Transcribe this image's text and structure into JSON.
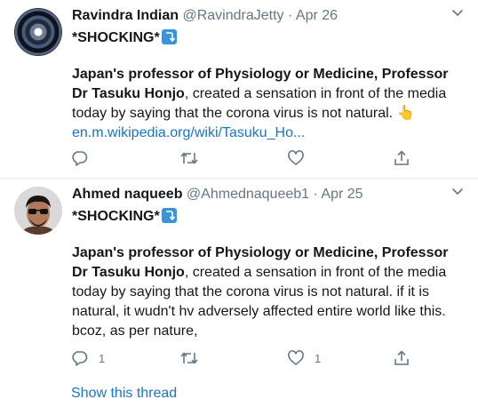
{
  "tweets": [
    {
      "display_name": "Ravindra Indian",
      "handle": "@RavindraJetty",
      "separator": "·",
      "date": "Apr 26",
      "shocking": "*SHOCKING*",
      "body_bold": "Japan's professor of Physiology or Medicine, Professor Dr Tasuku Honjo",
      "body_text": ", created a sensation in front of the media today by saying that the corona virus is not natural.",
      "emoji": "👆",
      "link": "en.m.wikipedia.org/wiki/Tasuku_Ho...",
      "reply_count": "",
      "like_count": ""
    },
    {
      "display_name": "Ahmed naqueeb",
      "handle": "@Ahmednaqueeb1",
      "separator": "·",
      "date": "Apr 25",
      "shocking": "*SHOCKING*",
      "body_bold": "Japan's professor of Physiology or Medicine, Professor Dr Tasuku Honjo",
      "body_text": ", created a sensation in front of the media today by saying that the corona virus is not natural. if it is natural, it wudn't hv adversely affected entire world like this. bcoz, as per nature,",
      "reply_count": "1",
      "like_count": "1",
      "show_thread": "Show this thread"
    }
  ],
  "colors": {
    "link": "#1b74c6",
    "muted": "#657786",
    "badge": "#3b94d9"
  },
  "icons": [
    "caret-down-icon",
    "reply-icon",
    "retweet-icon",
    "like-icon",
    "share-icon",
    "return-arrow-icon"
  ]
}
